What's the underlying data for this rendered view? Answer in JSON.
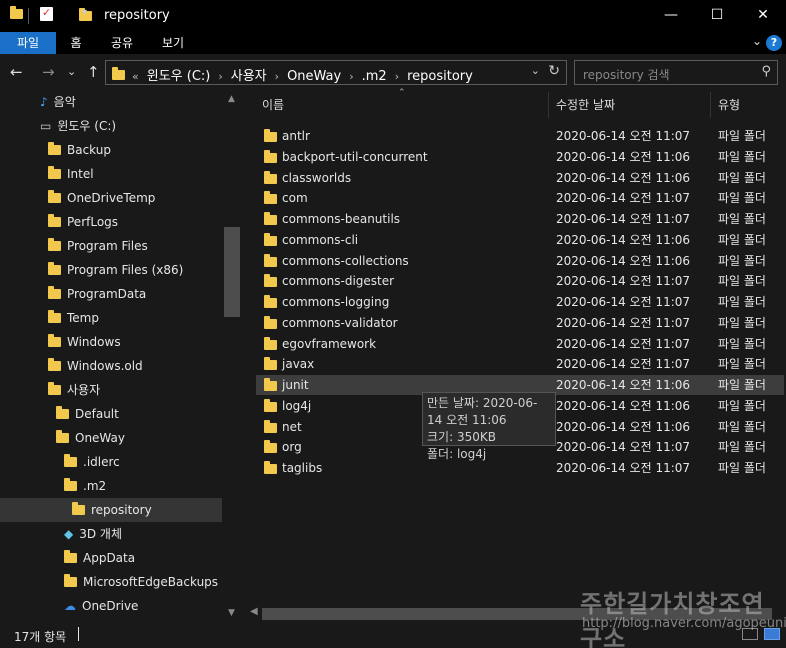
{
  "window": {
    "title": "repository",
    "minimize": "—",
    "maximize": "☐",
    "close": "✕"
  },
  "ribbon": {
    "tabs": [
      "파일",
      "홈",
      "공유",
      "보기"
    ],
    "active_tab": "파일",
    "help": "?"
  },
  "address": {
    "crumbs": [
      "윈도우 (C:)",
      "사용자",
      "OneWay",
      ".m2",
      "repository"
    ],
    "overflow": "«",
    "search_placeholder": "repository 검색"
  },
  "sidebar": {
    "items": [
      {
        "label": "음악",
        "icon": "music-note-icon",
        "indent": 0
      },
      {
        "label": "윈도우 (C:)",
        "icon": "drive-icon",
        "indent": 0
      },
      {
        "label": "Backup",
        "icon": "folder-icon",
        "indent": 1
      },
      {
        "label": "Intel",
        "icon": "folder-icon",
        "indent": 1
      },
      {
        "label": "OneDriveTemp",
        "icon": "folder-icon",
        "indent": 1
      },
      {
        "label": "PerfLogs",
        "icon": "folder-icon",
        "indent": 1
      },
      {
        "label": "Program Files",
        "icon": "folder-icon",
        "indent": 1
      },
      {
        "label": "Program Files (x86)",
        "icon": "folder-icon",
        "indent": 1
      },
      {
        "label": "ProgramData",
        "icon": "folder-icon",
        "indent": 1
      },
      {
        "label": "Temp",
        "icon": "folder-icon",
        "indent": 1
      },
      {
        "label": "Windows",
        "icon": "folder-icon",
        "indent": 1
      },
      {
        "label": "Windows.old",
        "icon": "folder-icon",
        "indent": 1
      },
      {
        "label": "사용자",
        "icon": "folder-icon",
        "indent": 1
      },
      {
        "label": "Default",
        "icon": "folder-icon",
        "indent": 2
      },
      {
        "label": "OneWay",
        "icon": "folder-icon",
        "indent": 2
      },
      {
        "label": ".idlerc",
        "icon": "folder-icon",
        "indent": 3
      },
      {
        "label": ".m2",
        "icon": "folder-icon",
        "indent": 3
      },
      {
        "label": "repository",
        "icon": "folder-icon",
        "indent": 4,
        "selected": true
      },
      {
        "label": "3D 개체",
        "icon": "3d-objects-icon",
        "indent": 3
      },
      {
        "label": "AppData",
        "icon": "folder-icon",
        "indent": 3
      },
      {
        "label": "MicrosoftEdgeBackups",
        "icon": "folder-icon",
        "indent": 3
      },
      {
        "label": "OneDrive",
        "icon": "onedrive-icon",
        "indent": 3
      }
    ]
  },
  "columns": {
    "name": "이름",
    "date": "수정한 날짜",
    "type": "유형"
  },
  "files": [
    {
      "name": "antlr",
      "date": "2020-06-14 오전 11:07",
      "type": "파일 폴더"
    },
    {
      "name": "backport-util-concurrent",
      "date": "2020-06-14 오전 11:06",
      "type": "파일 폴더"
    },
    {
      "name": "classworlds",
      "date": "2020-06-14 오전 11:06",
      "type": "파일 폴더"
    },
    {
      "name": "com",
      "date": "2020-06-14 오전 11:07",
      "type": "파일 폴더"
    },
    {
      "name": "commons-beanutils",
      "date": "2020-06-14 오전 11:07",
      "type": "파일 폴더"
    },
    {
      "name": "commons-cli",
      "date": "2020-06-14 오전 11:06",
      "type": "파일 폴더"
    },
    {
      "name": "commons-collections",
      "date": "2020-06-14 오전 11:06",
      "type": "파일 폴더"
    },
    {
      "name": "commons-digester",
      "date": "2020-06-14 오전 11:07",
      "type": "파일 폴더"
    },
    {
      "name": "commons-logging",
      "date": "2020-06-14 오전 11:07",
      "type": "파일 폴더"
    },
    {
      "name": "commons-validator",
      "date": "2020-06-14 오전 11:07",
      "type": "파일 폴더"
    },
    {
      "name": "egovframework",
      "date": "2020-06-14 오전 11:07",
      "type": "파일 폴더"
    },
    {
      "name": "javax",
      "date": "2020-06-14 오전 11:07",
      "type": "파일 폴더"
    },
    {
      "name": "junit",
      "date": "2020-06-14 오전 11:06",
      "type": "파일 폴더",
      "hover": true
    },
    {
      "name": "log4j",
      "date": "2020-06-14 오전 11:06",
      "type": "파일 폴더"
    },
    {
      "name": "net",
      "date": "2020-06-14 오전 11:06",
      "type": "파일 폴더"
    },
    {
      "name": "org",
      "date": "2020-06-14 오전 11:07",
      "type": "파일 폴더"
    },
    {
      "name": "taglibs",
      "date": "2020-06-14 오전 11:07",
      "type": "파일 폴더"
    }
  ],
  "tooltip": {
    "line1": "만든 날짜: 2020-06-14 오전 11:06",
    "line2": "크기: 350KB",
    "line3": "폴더: log4j"
  },
  "status": {
    "count": "17개 항목"
  },
  "watermark": {
    "title": "주한길가치창조연구소",
    "url": "http://blog.naver.com/agopeuni"
  },
  "colors": {
    "folder": "#f2c94c",
    "accent": "#1a6fc7",
    "background": "#191919"
  }
}
